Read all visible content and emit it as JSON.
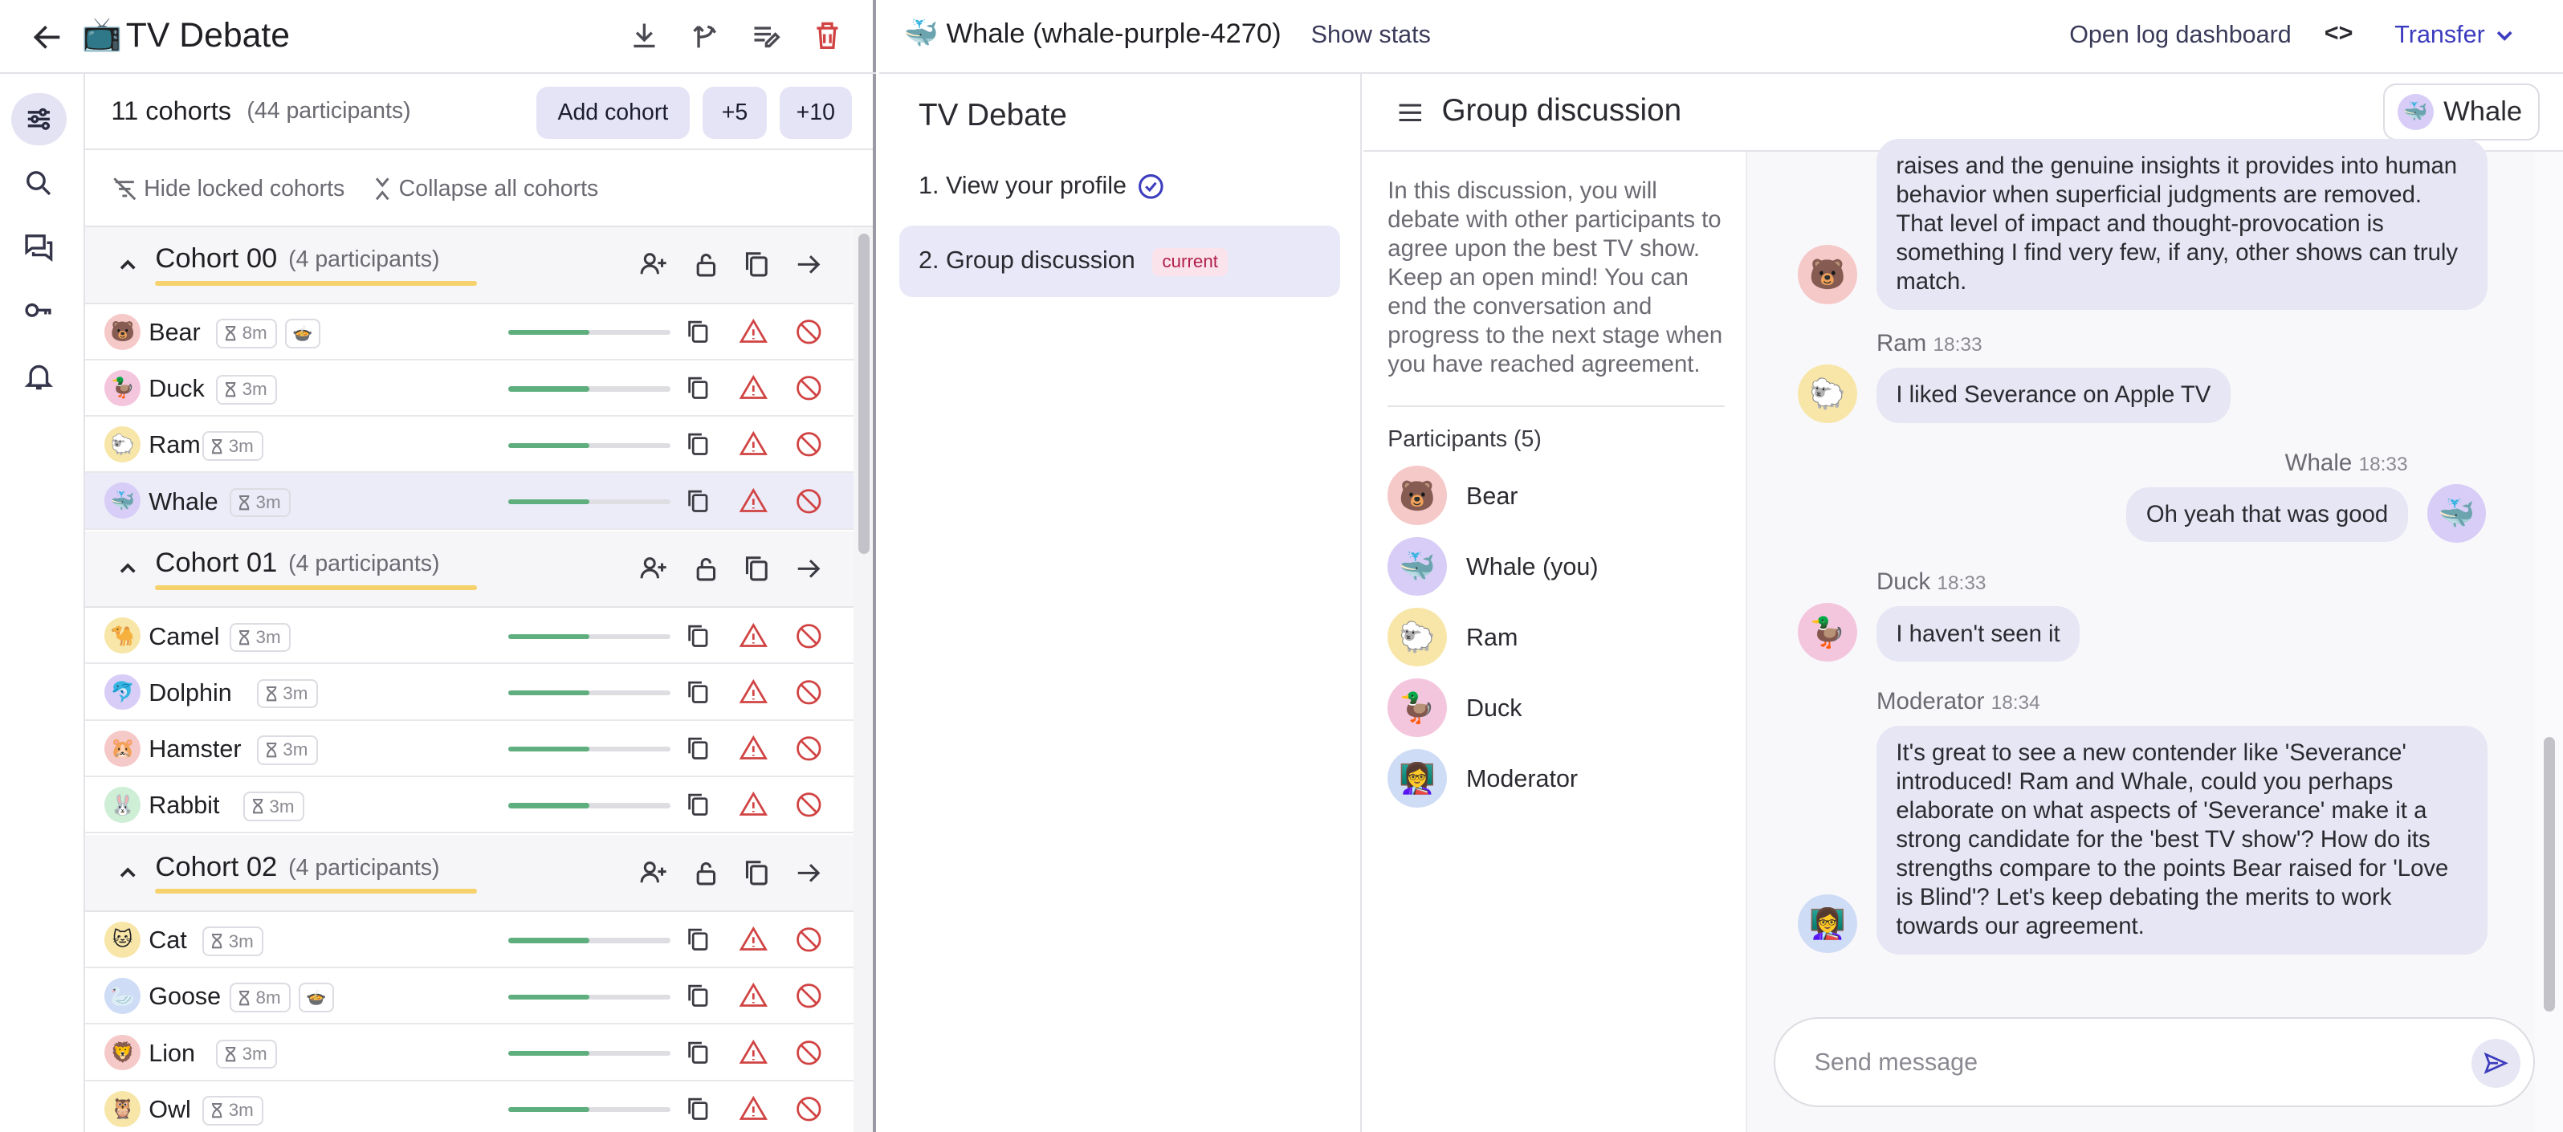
{
  "header": {
    "emoji": "📺",
    "title": "TV Debate"
  },
  "cohort_bar": {
    "count_label": "11 cohorts",
    "total_label": "(44 participants)",
    "add_cohort": "Add cohort",
    "plus5": "+5",
    "plus10": "+10"
  },
  "filters": {
    "hide_locked": "Hide locked cohorts",
    "collapse_all": "Collapse all cohorts"
  },
  "cohorts": [
    {
      "name": "Cohort 00",
      "sub": "(4 participants)",
      "participants": [
        {
          "emoji": "🐻",
          "name": "Bear",
          "timer": "8m",
          "extra": "🍲",
          "progress": 0.5,
          "bg": "#f6c9c9"
        },
        {
          "emoji": "🦆",
          "name": "Duck",
          "timer": "3m",
          "progress": 0.5,
          "bg": "#f4c6de"
        },
        {
          "emoji": "🐑",
          "name": "Ram",
          "timer": "3m",
          "progress": 0.5,
          "bg": "#f8e6a8"
        },
        {
          "emoji": "🐳",
          "name": "Whale",
          "timer": "3m",
          "progress": 0.5,
          "bg": "#d8cdf6"
        }
      ]
    },
    {
      "name": "Cohort 01",
      "sub": "(4 participants)",
      "participants": [
        {
          "emoji": "🐪",
          "name": "Camel",
          "timer": "3m",
          "progress": 0.5,
          "bg": "#f8e6a8"
        },
        {
          "emoji": "🐬",
          "name": "Dolphin",
          "timer": "3m",
          "progress": 0.5,
          "bg": "#d8cdf6"
        },
        {
          "emoji": "🐹",
          "name": "Hamster",
          "timer": "3m",
          "progress": 0.5,
          "bg": "#f6c9c9"
        },
        {
          "emoji": "🐰",
          "name": "Rabbit",
          "timer": "3m",
          "progress": 0.5,
          "bg": "#cfeed6"
        }
      ]
    },
    {
      "name": "Cohort 02",
      "sub": "(4 participants)",
      "participants": [
        {
          "emoji": "🐱",
          "name": "Cat",
          "timer": "3m",
          "progress": 0.5,
          "bg": "#f8e6a8"
        },
        {
          "emoji": "🦢",
          "name": "Goose",
          "timer": "8m",
          "extra": "🍲",
          "progress": 0.5,
          "bg": "#cfdcf6"
        },
        {
          "emoji": "🦁",
          "name": "Lion",
          "timer": "3m",
          "progress": 0.5,
          "bg": "#f6c9c9"
        },
        {
          "emoji": "🦉",
          "name": "Owl",
          "timer": "3m",
          "progress": 0.5,
          "bg": "#f8e6a8"
        }
      ]
    }
  ],
  "right": {
    "who_emoji": "🐳",
    "who": "Whale (whale-purple-4270)",
    "show_stats": "Show stats",
    "open_log": "Open log dashboard",
    "code_icon": "<>",
    "transfer": "Transfer",
    "nav_title": "TV Debate",
    "nav_items": [
      {
        "label": "1. View your profile"
      },
      {
        "label": "2. Group discussion",
        "tag": "current"
      }
    ],
    "stage_title": "Group discussion",
    "chip_emoji": "🐳",
    "chip_label": "Whale",
    "description": "In this discussion, you will debate with other participants to agree upon the best TV show. Keep an open mind! You can end the conversation and progress to the next stage when you have reached agreement.",
    "participants_title": "Participants (5)",
    "participants": [
      {
        "emoji": "🐻",
        "name": "Bear",
        "bg": "#f6c9c9"
      },
      {
        "emoji": "🐳",
        "name": "Whale (you)",
        "bg": "#d8cdf6"
      },
      {
        "emoji": "🐑",
        "name": "Ram",
        "bg": "#f8e6a8"
      },
      {
        "emoji": "🦆",
        "name": "Duck",
        "bg": "#f4c6de"
      },
      {
        "emoji": "👩‍🏫",
        "name": "Moderator",
        "bg": "#cfdcf6"
      }
    ],
    "messages": [
      {
        "emoji": "🐻",
        "text": "raises and the genuine insights it provides into human behavior when superficial judgments are removed. That level of impact and thought-provocation is something I find very few, if any, other shows can truly match."
      },
      {
        "emoji": "🐑",
        "name": "Ram",
        "time": "18:33",
        "text": "I liked Severance on Apple TV"
      },
      {
        "emoji": "🐳",
        "name": "Whale",
        "time": "18:33",
        "text": "Oh yeah that was good"
      },
      {
        "emoji": "🦆",
        "name": "Duck",
        "time": "18:33",
        "text": "I haven't seen it"
      },
      {
        "emoji": "👩‍🏫",
        "name": "Moderator",
        "time": "18:34",
        "text": "It's great to see a new contender like 'Severance' introduced! Ram and Whale, could you perhaps elaborate on what aspects of 'Severance' make it a strong candidate for the 'best TV show'? How do its strengths compare to the points Bear raised for 'Love is Blind'? Let's keep debating the merits to work towards our agreement."
      }
    ],
    "composer_placeholder": "Send message"
  },
  "colors": {
    "accent": "#3c3cbe",
    "danger": "#d14343",
    "progress": "#5fae7e",
    "underline": "#f5d26b"
  }
}
